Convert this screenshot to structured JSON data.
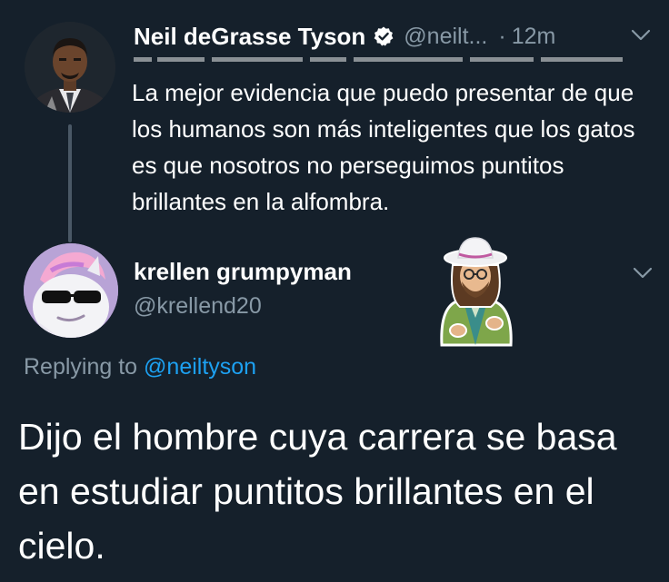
{
  "original_tweet": {
    "display_name": "Neil deGrasse Tyson",
    "handle": "@neilt...",
    "separator": "·",
    "time": "12m",
    "text": "La mejor evidencia que puedo presentar de que los humanos son más inteligentes que los gatos es que nosotros no perseguimos puntitos brillantes en la alfombra.",
    "verified_icon": "verified-badge-icon",
    "menu_icon": "chevron-down-icon"
  },
  "reply_tweet": {
    "display_name": "krellen grumpyman",
    "handle": "@krellend20",
    "replying_to_label": "Replying to",
    "replying_to_handle": "@neiltyson",
    "text": "Dijo el hombre cuya carrera se basa en estudiar puntitos brillantes en el cielo.",
    "menu_icon": "chevron-down-icon"
  },
  "colors": {
    "background": "#15202b",
    "text": "#ffffff",
    "secondary_text": "#8899a6",
    "link": "#1da1f2",
    "thread_line": "#4a5866"
  }
}
